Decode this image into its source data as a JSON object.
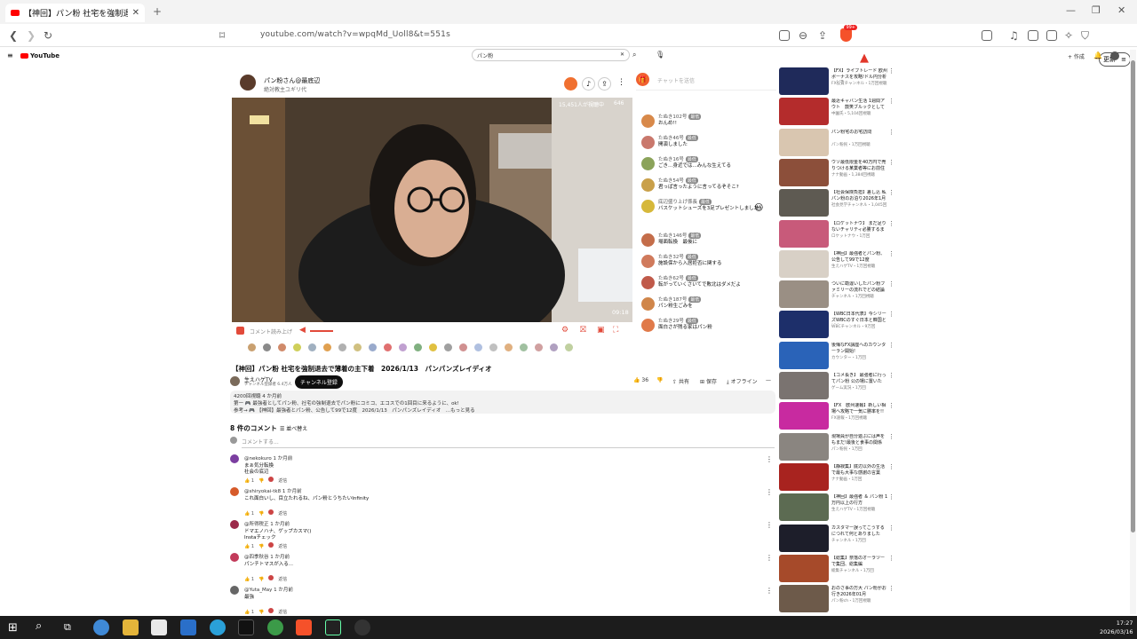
{
  "browser": {
    "tab_title": "【神回】パン粉 社宅を強制退去",
    "url": "youtube.com/watch?v=wpqMd_Uoll8&t=551s",
    "profile_label": "更新"
  },
  "youtube": {
    "logo": "YouTube",
    "search_value": "パン粉",
    "create_label": "+ 作成"
  },
  "video": {
    "channel_name": "パン粉さん@最底辺",
    "channel_sub": "絶対教主ユギリ代",
    "live_viewers": "15,451人が視聴中",
    "chat_count": "646",
    "timestamp": "09:18",
    "comment_prompt": "コメント読み上げ",
    "title": "【神回】パン粉 社宅を強制退去で薄着の主下着　2026/1/13　パンパンズレイディオ",
    "uploader": "生えハゲTV",
    "uploader_subs": "チャンネル登録者 6.4万人",
    "subscribe_label": "チャンネル登録",
    "actions": [
      "36",
      "共有",
      "保存",
      "オフライン"
    ],
    "description_lines": [
      "4200回視聴 4 か月前",
      "第一 🎮 最強者としてパン粉、社宅の強制退去でパン粉にコミコ、エコスでの1回目に来るように、ok!",
      "参考→ 🎮 【神回】最強者とパン粉、公告して99で12度　2026/1/13　パンパンズレイディオ　...もっと見る"
    ]
  },
  "comments": {
    "count_label": "8 件のコメント",
    "sort_label": "並べ替え",
    "add_placeholder": "コメントする...",
    "items": [
      {
        "name": "@nekokuro  1 か月前",
        "text": "まぁ気分転換",
        "text2": "社会の底辺",
        "avatar_color": "#7b3ea0"
      },
      {
        "name": "@shiryokai-tk8  1 か月前",
        "text": "これ面白いし、目立たれるね、パン粉とうちたいInfinity",
        "text2": "",
        "avatar_color": "#d65a2a"
      },
      {
        "name": "@所得税正  1 か月前",
        "text": "ドマエノハナ、ゲップカスマ()",
        "text2": "Instaチェック",
        "avatar_color": "#9c2a4a"
      },
      {
        "name": "@四季秋谷  1 か月前",
        "text": "パンチトマスが入る...",
        "text2": "",
        "avatar_color": "#c23a5a"
      },
      {
        "name": "@Yuta_May  1 か月前",
        "text": "最強",
        "text2": "",
        "avatar_color": "#666"
      }
    ],
    "reply_label": "返信"
  },
  "chat": {
    "input_placeholder": "チャットを送信",
    "messages": [
      {
        "name": "たぬき102号",
        "tag": "最低",
        "text": "おんめ!!",
        "color": "#d8894a"
      },
      {
        "name": "たぬき46号",
        "tag": "最低",
        "text": "開演しました",
        "color": "#c9786c"
      },
      {
        "name": "たぬき16号",
        "tag": "最低",
        "text": "ごき…身近では...みんな生えてる",
        "color": "#8ba35a"
      },
      {
        "name": "たぬき54号",
        "tag": "最低",
        "text": "君っぱ言ったように言ってるぞそこ?",
        "color": "#c9a04a"
      },
      {
        "name": "底辺盛り上げ係長",
        "tag": "最低",
        "text": "バスケットシューズを3足プレゼントしました",
        "color": "#d6b83a"
      },
      {
        "name": "たぬき146号",
        "tag": "最低",
        "text": "場面転換　最後に",
        "color": "#c46d4a"
      },
      {
        "name": "たぬき32号",
        "tag": "最低",
        "text": "施設保から入居拒否に関する",
        "color": "#d07a5c"
      },
      {
        "name": "たぬき62号",
        "tag": "最低",
        "text": "転がっていくさいてで敗北はダメだよ",
        "color": "#c05a4a"
      },
      {
        "name": "たぬき187号",
        "tag": "最低",
        "text": "パン粉生ごみを",
        "color": "#d0864a"
      },
      {
        "name": "たぬき29号",
        "tag": "最低",
        "text": "面白さが残る家はパン粉",
        "color": "#e07a4a"
      }
    ]
  },
  "recommendations": [
    {
      "title": "【FX】ライブトレード 欧州ボーナスを攻略!ドル円分析&実況",
      "meta": "FX投資チャンネル・1万回視聴",
      "thumb": "#1f2a5a"
    },
    {
      "title": "最近キャバン生活 1週間アウト　鼓笑ブルックとしてはバター",
      "meta": "中園氏・5,104回視聴",
      "thumb": "#b42c2c"
    },
    {
      "title": "パン粉宅のお宅訪問",
      "meta": "パン粉民・1万回視聴",
      "thumb": "#d9c6b0"
    },
    {
      "title": "ウソ最低限金を40万円で売りつける某業者等にお前住んでる",
      "meta": "ナナ動画・1,384回視聴",
      "thumb": "#8c4f3a"
    },
    {
      "title": "【社会保険負担】差し込 私 パン粉のお泊り2026年1月14日",
      "meta": "社会見学チャンネル・1,045回",
      "thumb": "#5e5a52"
    },
    {
      "title": "【ロケットナウ】 まだ足りないチャリティ必勝するまで!",
      "meta": "ロケットナウ・1万回",
      "thumb": "#c85a7a"
    },
    {
      "title": "【神回】最強者とパン粉、公告して99で12度　2026/1/13",
      "meta": "生えハゲTV・1万回視聴",
      "thumb": "#d8d0c6"
    },
    {
      "title": "ついに勘違いしたパン粉ファミリーの流れでどの結論が",
      "meta": "チャンネル・1万回視聴",
      "thumb": "#9a8f84"
    },
    {
      "title": "【WBC日本代表】今シリーズWBCのすぐ日本と韓国と試合",
      "meta": "WBCチャンネル・9万回",
      "thumb": "#1d2f6a"
    },
    {
      "title": "後悔なFX講座へのカウンターラン開始!",
      "meta": "カウンター・1万回",
      "thumb": "#2a63b8"
    },
    {
      "title": "【コメ長き】 最強者に行ってパン粉 公の場に置いた",
      "meta": "ゲーム実況・1万回",
      "thumb": "#7a7370"
    },
    {
      "title": "【FX　欧州速報】新しい相場へ攻略で一気に勝率を!!",
      "meta": "FX速報・1万回視聴",
      "thumb": "#c82aa0"
    },
    {
      "title": "現場員が自分遊ぶには声をもまだ!最後と食事の関係",
      "meta": "パン粉民・1万回",
      "thumb": "#8a8580"
    },
    {
      "title": "【静寂集】底辺以外の生活で最も大事な感謝の言葉",
      "meta": "ナナ動画・1万回",
      "thumb": "#a8231f"
    },
    {
      "title": "【神回】最強者 ＆ パン粉 1万円以上の行方",
      "meta": "生えハゲTV・1万回視聴",
      "thumb": "#5c6b52"
    },
    {
      "title": "カスタマー誤ってこうするにつれて何とありました　2026/1/1",
      "meta": "チャンネル・1万回",
      "thumb": "#1d1e2a"
    },
    {
      "title": "【総集】奈落のオーラツーで集団、総集編",
      "meta": "総集チャンネル・1万回",
      "thumb": "#a64a2a"
    },
    {
      "title": "おのさ事の万大 パン粉がお行き2026年01月",
      "meta": "パン粉ch・1万回視聴",
      "thumb": "#6d5a4a"
    }
  ],
  "taskbar": {
    "time": "17:27",
    "date": "2026/03/16"
  }
}
